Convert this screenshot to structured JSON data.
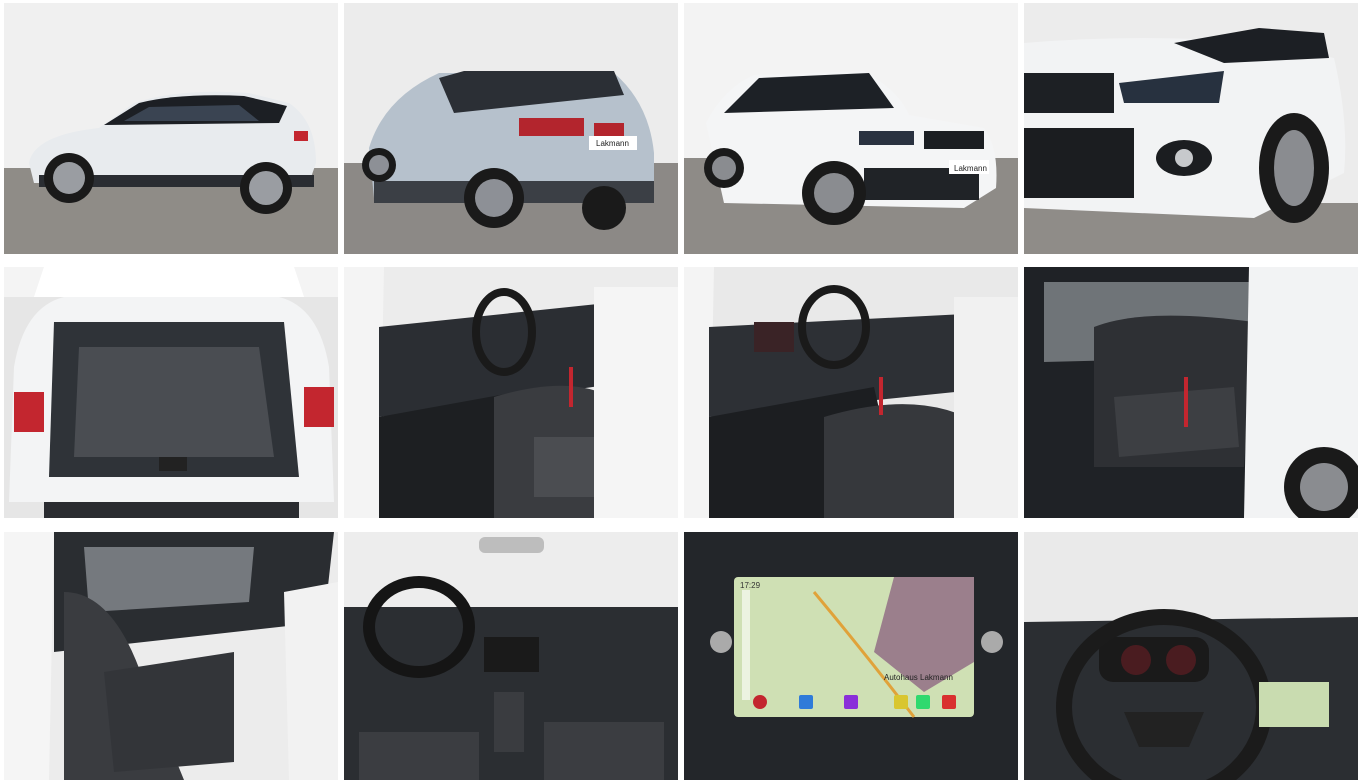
{
  "gallery": {
    "columns": 4,
    "rows": 3,
    "photos": [
      {
        "subject": "car-side-view",
        "plate_text": ""
      },
      {
        "subject": "car-rear-three-quarter-view",
        "plate_text": "Lakmann"
      },
      {
        "subject": "car-front-three-quarter-view",
        "plate_text": "Lakmann"
      },
      {
        "subject": "car-front-closeup"
      },
      {
        "subject": "open-trunk"
      },
      {
        "subject": "driver-seat-interior"
      },
      {
        "subject": "cockpit-from-door"
      },
      {
        "subject": "rear-seats"
      },
      {
        "subject": "passenger-seat-interior"
      },
      {
        "subject": "dashboard-overview"
      },
      {
        "subject": "infotainment-navigation-screen",
        "screen_time": "17:29",
        "screen_place": "Autohaus Lakmann"
      },
      {
        "subject": "steering-wheel-and-cluster"
      }
    ],
    "colors": {
      "body_white": "#f1f3f4",
      "roof_black": "#1b1e22",
      "accent_red": "#c3262f",
      "floor_gray": "#8c8a86",
      "wall_white": "#f2f2f2"
    }
  }
}
